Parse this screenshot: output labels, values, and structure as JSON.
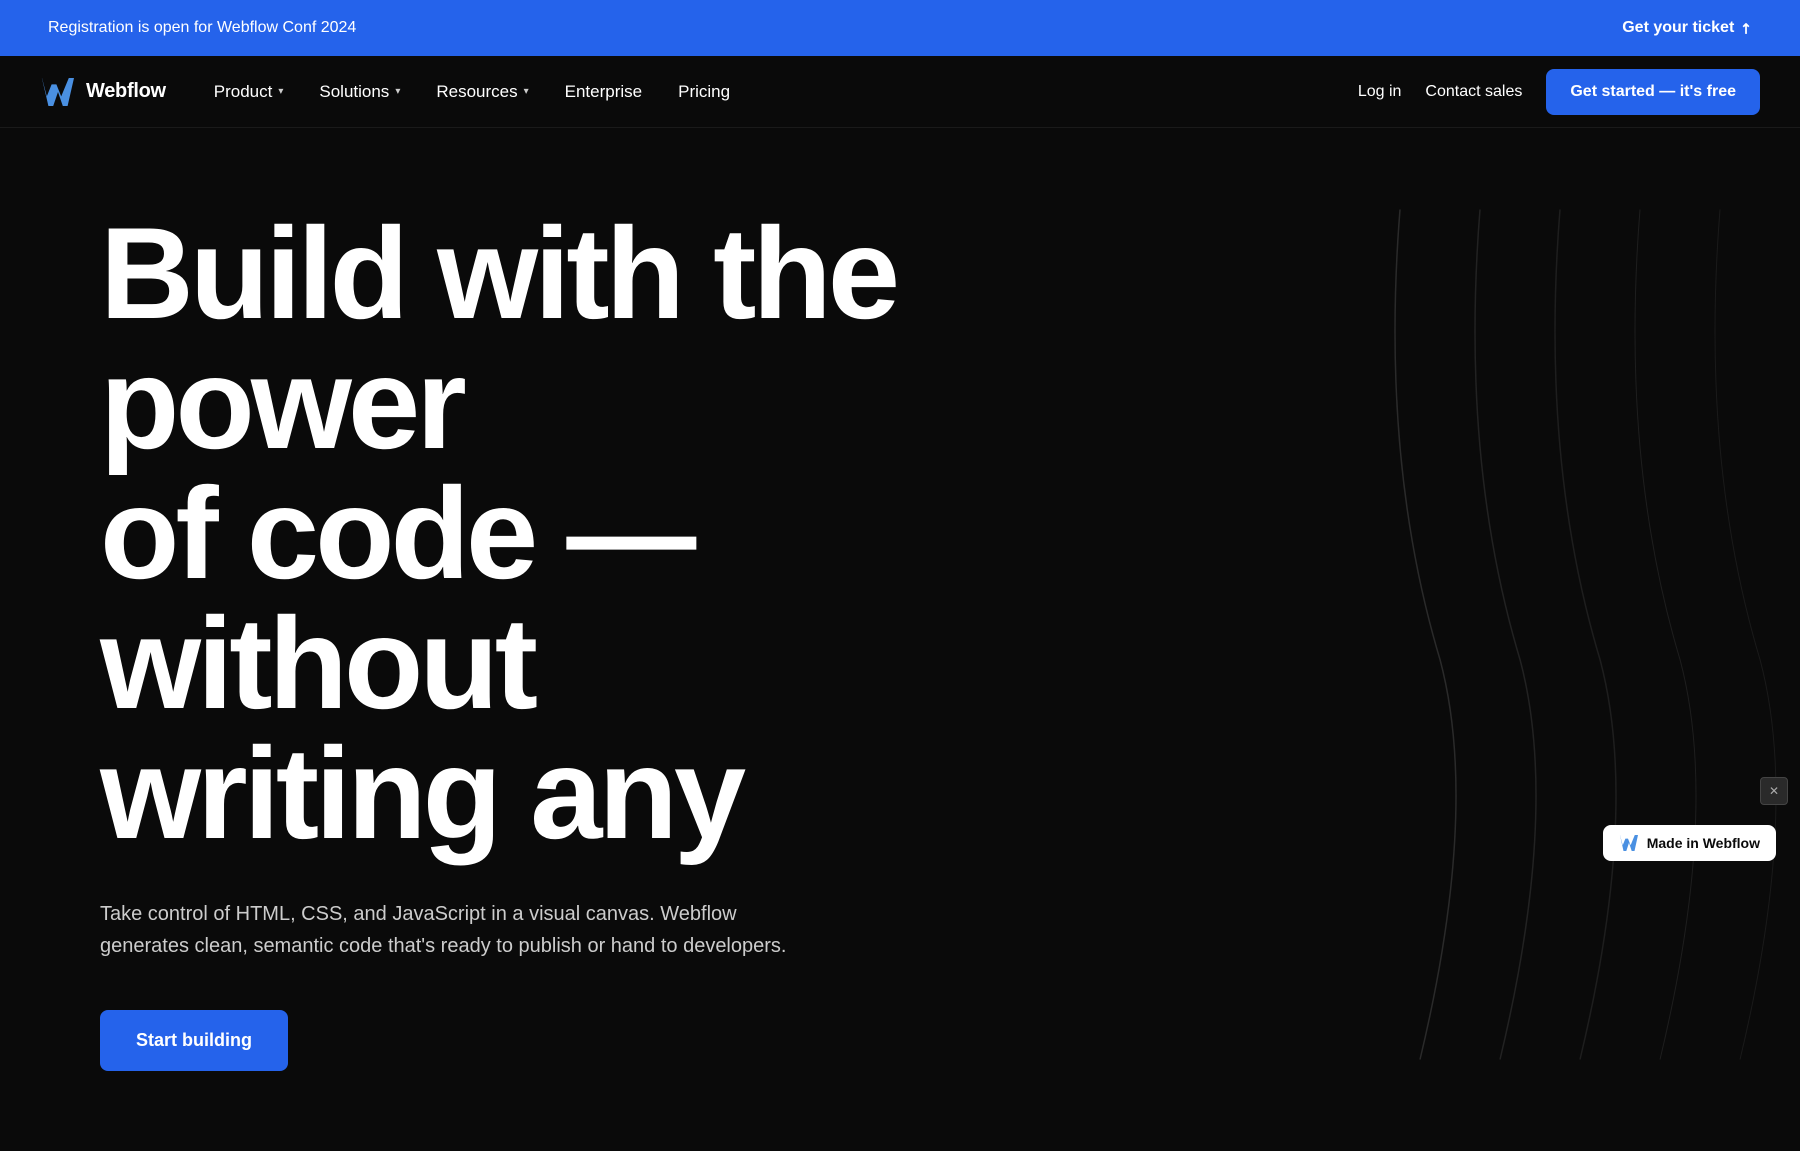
{
  "colors": {
    "blue_accent": "#2563eb",
    "background": "#0a0a0a",
    "white": "#ffffff",
    "subtext": "#cccccc"
  },
  "announcement": {
    "text": "Registration is open for Webflow Conf 2024",
    "link_label": "Get your ticket",
    "link_arrow": "↗"
  },
  "navbar": {
    "logo_text": "Webflow",
    "nav_items": [
      {
        "label": "Product",
        "has_dropdown": true
      },
      {
        "label": "Solutions",
        "has_dropdown": true
      },
      {
        "label": "Resources",
        "has_dropdown": true
      },
      {
        "label": "Enterprise",
        "has_dropdown": false
      },
      {
        "label": "Pricing",
        "has_dropdown": false
      }
    ],
    "right_links": [
      {
        "label": "Log in"
      },
      {
        "label": "Contact sales"
      }
    ],
    "cta_label": "Get started — it's free"
  },
  "hero": {
    "headline_line1": "Build with the power",
    "headline_line2": "of code — without",
    "headline_line3": "writing any",
    "subtext": "Take control of HTML, CSS, and JavaScript in a visual canvas. Webflow generates clean, semantic code that's ready to publish or hand to developers.",
    "cta_label": "Start building"
  },
  "badge": {
    "label": "Made in Webflow"
  },
  "corner_btn": {
    "label": "✕"
  }
}
